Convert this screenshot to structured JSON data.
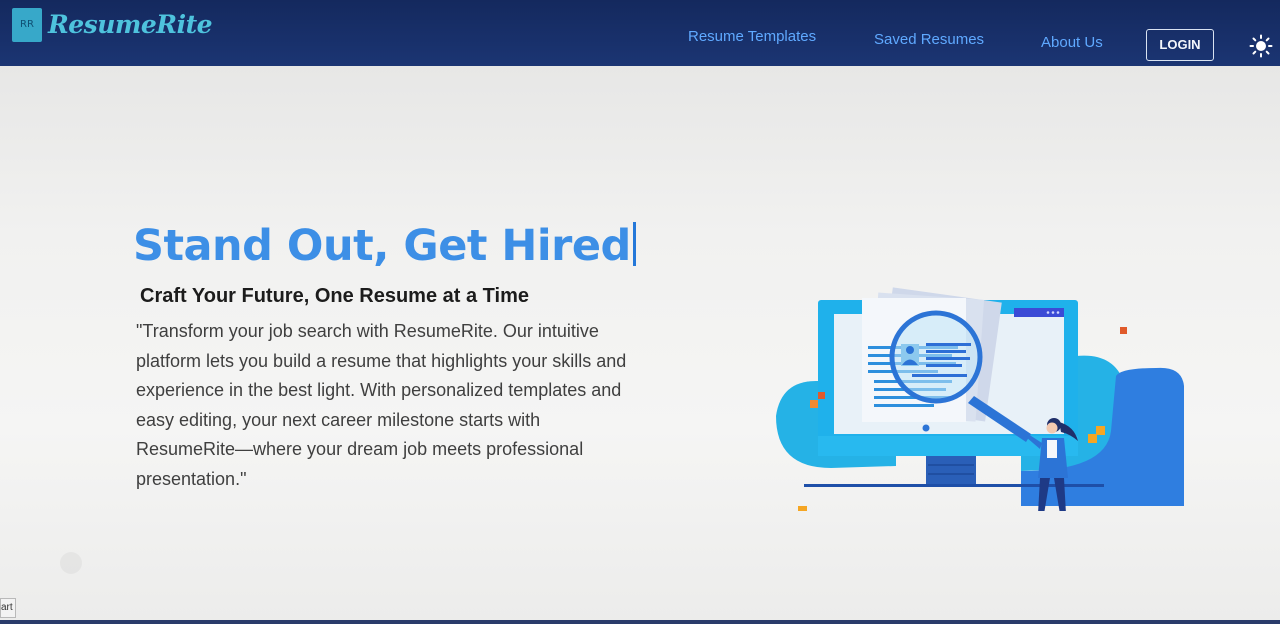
{
  "header": {
    "logo_badge": "RR",
    "brand": "ResumeRite",
    "nav": {
      "templates": "Resume Templates",
      "saved": "Saved Resumes",
      "about": "About Us"
    },
    "login_label": "LOGIN",
    "theme_toggle_icon": "sun-icon"
  },
  "hero": {
    "title": "Stand Out, Get Hired",
    "subtitle": "Craft Your Future, One Resume at a Time",
    "description_lines": [
      "\"Transform your job search with ResumeRite. Our intuitive",
      "platform lets you build a resume that highlights your skills and",
      "experience in the best light. With personalized templates and",
      "easy editing, your next career milestone starts with",
      "ResumeRite—where your dream job meets professional",
      "presentation.\""
    ],
    "illustration": "resume-review-illustration"
  },
  "status_tooltip": "art",
  "colors": {
    "navbar": "#1b3573",
    "brand": "#4ec3dd",
    "nav_link": "#5fa9ff",
    "title": "#3d8fe6",
    "illustration_blue": "#29b6e8"
  }
}
